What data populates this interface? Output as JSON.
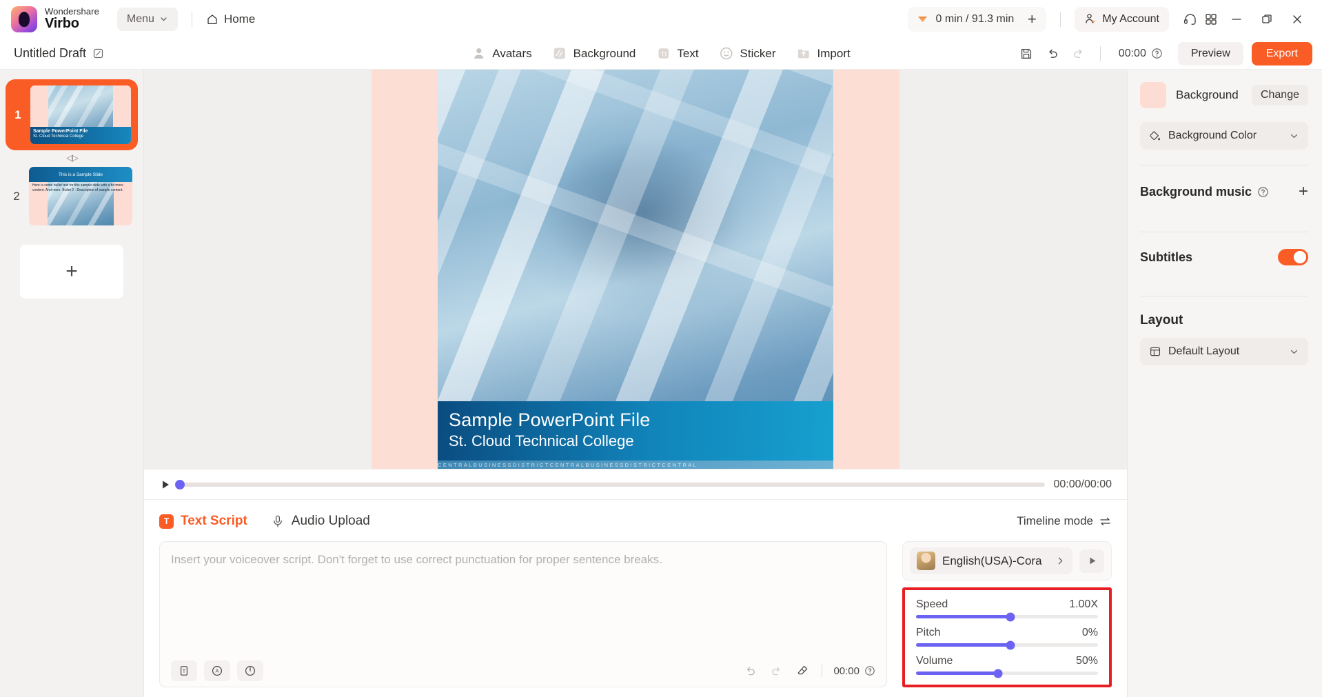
{
  "titlebar": {
    "brand_top": "Wondershare",
    "brand_bottom": "Virbo",
    "menu_label": "Menu",
    "home_label": "Home",
    "credits": "0 min / 91.3 min",
    "add_credits_label": "+",
    "account_label": "My Account",
    "icons": {
      "headset": "headset-icon",
      "grid": "apps-grid-icon",
      "minimize": "minimize-icon",
      "maximize": "maximize-icon",
      "close": "close-icon"
    }
  },
  "toolbar": {
    "project_title": "Untitled Draft",
    "tools": [
      {
        "label": "Avatars",
        "icon": "avatar-icon"
      },
      {
        "label": "Background",
        "icon": "background-icon"
      },
      {
        "label": "Text",
        "icon": "text-icon"
      },
      {
        "label": "Sticker",
        "icon": "sticker-icon"
      },
      {
        "label": "Import",
        "icon": "import-icon"
      }
    ],
    "save_icon": "save-icon",
    "undo_icon": "undo-icon",
    "redo_icon": "redo-icon",
    "duration": "00:00",
    "help_icon": "help-icon",
    "preview_label": "Preview",
    "export_label": "Export"
  },
  "sidebar": {
    "slides": [
      {
        "number": "1",
        "selected": true,
        "title": "Sample PowerPoint File",
        "subtitle": "St. Cloud Technical College"
      },
      {
        "number": "2",
        "selected": false,
        "title": "This is a Sample Slide",
        "body": "Here is some bullet text for this sample slide with a bit more content. And more. Bullet 2 - Description of sample content."
      }
    ],
    "transition_icon": "transition-icon",
    "add_slide_label": "+"
  },
  "canvas": {
    "caption_line1": "Sample PowerPoint File",
    "caption_line2": "St. Cloud Technical College",
    "footer_text": "CENTRALBUSINESSDISTRICTCENTRALBUSINESSDISTRICTCENTRAL"
  },
  "playbar": {
    "play_icon": "play-icon",
    "progress_percent": 0,
    "time": "00:00/00:00"
  },
  "lower": {
    "tabs": [
      {
        "label": "Text Script",
        "icon": "T",
        "active": true
      },
      {
        "label": "Audio Upload",
        "icon": "microphone-icon",
        "active": false
      }
    ],
    "timeline_mode_label": "Timeline mode",
    "script_placeholder": "Insert your voiceover script. Don't forget to use correct punctuation for proper sentence breaks.",
    "script_value": "",
    "script_tools": [
      {
        "name": "text-format-icon"
      },
      {
        "name": "pronunciation-icon"
      },
      {
        "name": "pause-icon"
      }
    ],
    "undo_icon": "undo-icon",
    "redo_icon": "redo-icon",
    "clear-icon": "eraser-icon",
    "script_time": "00:00",
    "script_help_icon": "help-icon"
  },
  "voice": {
    "name": "English(USA)-Cora",
    "preview_icon": "play-icon",
    "expand_icon": "chevron-right-icon",
    "sliders": [
      {
        "label": "Speed",
        "value": "1.00X",
        "percent": 52
      },
      {
        "label": "Pitch",
        "value": "0%",
        "percent": 52
      },
      {
        "label": "Volume",
        "value": "50%",
        "percent": 45
      }
    ]
  },
  "rightpanel": {
    "background_label": "Background",
    "change_label": "Change",
    "background_color_label": "Background Color",
    "background_music_label": "Background music",
    "add_music_label": "+",
    "subtitles_label": "Subtitles",
    "subtitles_on": true,
    "layout_title": "Layout",
    "layout_value": "Default Layout"
  },
  "colors": {
    "accent": "#fa5c26",
    "slider": "#6c63f2",
    "highlight_border": "#e81f22",
    "panel_bg": "#f7f5f4"
  }
}
